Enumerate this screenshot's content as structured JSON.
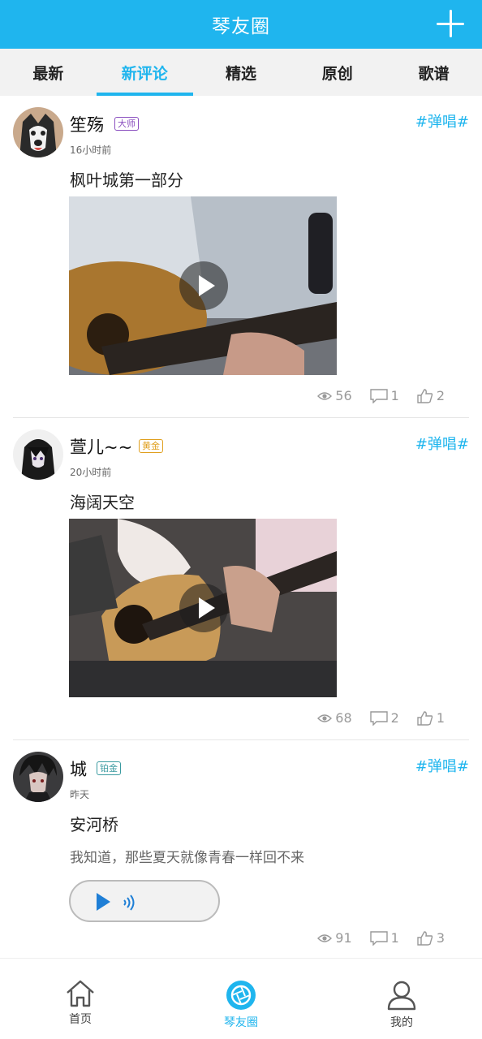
{
  "header": {
    "title": "琴友圈",
    "add_button": "plus-icon"
  },
  "tabs": [
    {
      "label": "最新"
    },
    {
      "label": "新评论"
    },
    {
      "label": "精选"
    },
    {
      "label": "原创"
    },
    {
      "label": "歌谱"
    }
  ],
  "active_tab": "新评论",
  "posts": [
    {
      "user": "笙殇",
      "badge": "大师",
      "badge_color": "#8a4fbf",
      "time": "16小时前",
      "tag": "#弹唱#",
      "title": "枫叶城第一部分",
      "media": "video",
      "views": "56",
      "comments": "1",
      "likes": "2"
    },
    {
      "user": "萱儿~~",
      "badge": "黄金",
      "badge_color": "#e0a020",
      "time": "20小时前",
      "tag": "#弹唱#",
      "title": "海阔天空",
      "media": "video",
      "views": "68",
      "comments": "2",
      "likes": "1"
    },
    {
      "user": "城",
      "badge": "铂金",
      "badge_color": "#3a9aa0",
      "time": "昨天",
      "tag": "#弹唱#",
      "title": "安河桥",
      "description": "我知道，那些夏天就像青春一样回不来",
      "media": "audio",
      "views": "91",
      "comments": "1",
      "likes": "3"
    }
  ],
  "bottom_nav": [
    {
      "label": "首页",
      "icon": "home-icon"
    },
    {
      "label": "琴友圈",
      "icon": "aperture-icon"
    },
    {
      "label": "我的",
      "icon": "user-icon"
    }
  ],
  "colors": {
    "accent": "#1fb5ee",
    "tab_bg": "#f2f2f2",
    "audio_play": "#1f7fd6"
  }
}
